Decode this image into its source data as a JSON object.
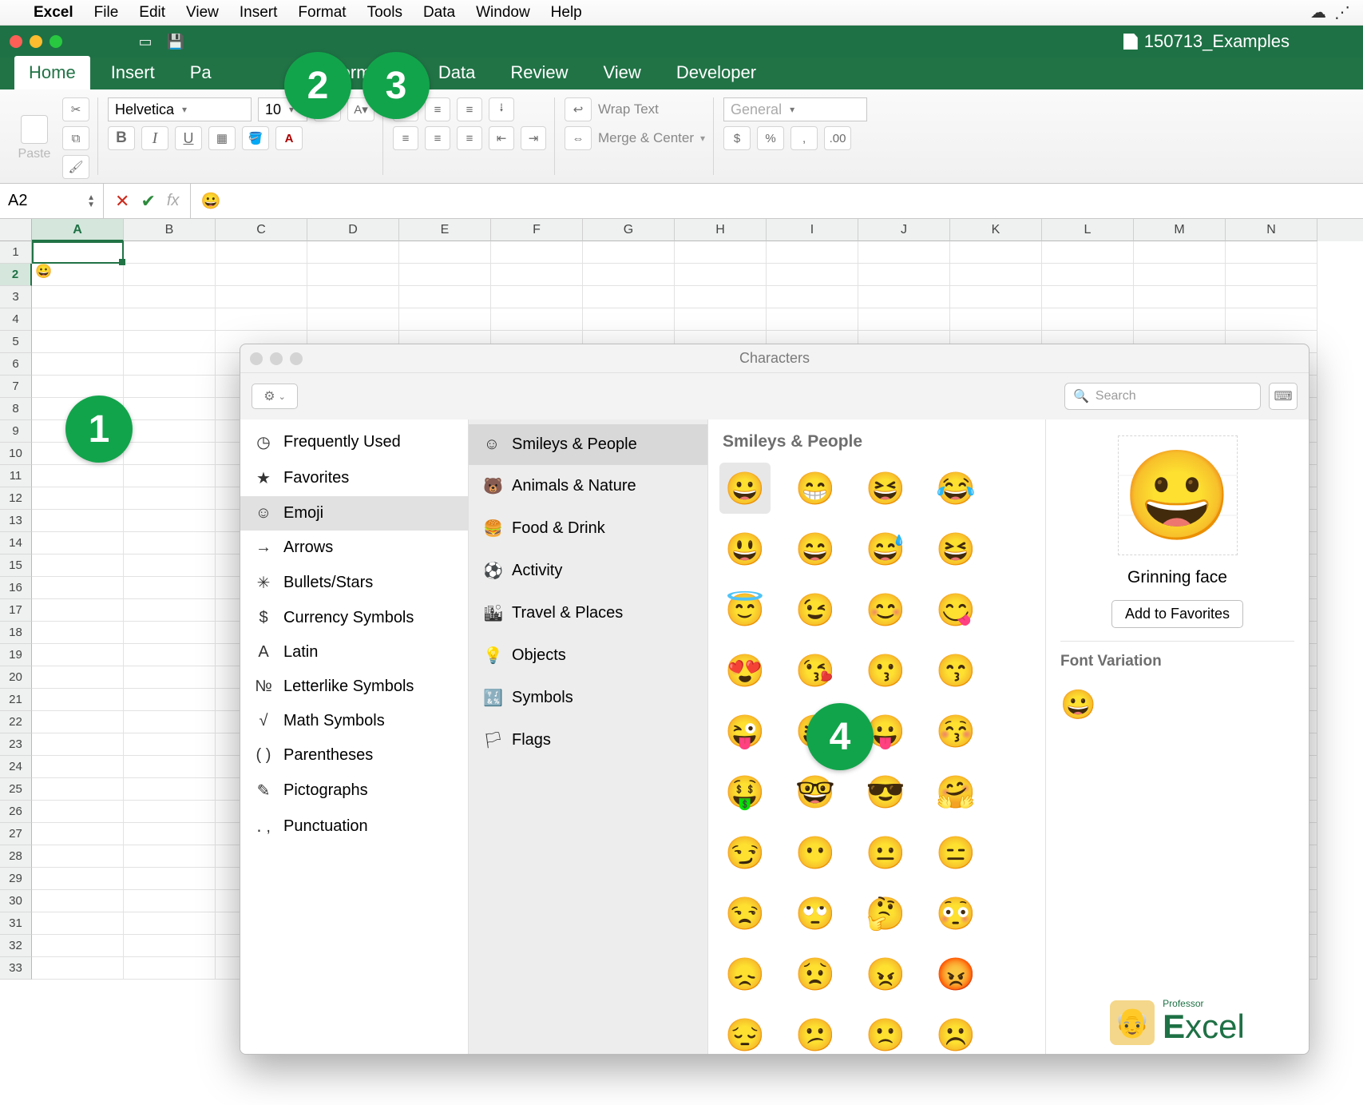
{
  "mac_menu": {
    "app": "Excel",
    "items": [
      "File",
      "Edit",
      "View",
      "Insert",
      "Format",
      "Tools",
      "Data",
      "Window",
      "Help"
    ]
  },
  "doc_title": "150713_Examples",
  "ribbon_tabs": [
    "Home",
    "Insert",
    "Pa",
    "ormulas",
    "Data",
    "Review",
    "View",
    "Developer"
  ],
  "ribbon_active": "Home",
  "paste_label": "Paste",
  "font": {
    "name": "Helvetica",
    "size": "10"
  },
  "wrap_label": "Wrap Text",
  "merge_label": "Merge & Center",
  "num_format": "General",
  "namebox": "A2",
  "formula_value": "😀",
  "columns": [
    "A",
    "B",
    "C",
    "D",
    "E",
    "F",
    "G",
    "H",
    "I",
    "J",
    "K",
    "L",
    "M",
    "N"
  ],
  "active_col": "A",
  "active_row": 2,
  "row_count": 33,
  "cell_A2": "😀",
  "badges": {
    "b1": "1",
    "b2": "2",
    "b3": "3",
    "b4": "4"
  },
  "char_window": {
    "title": "Characters",
    "search_placeholder": "Search",
    "cat1": [
      {
        "icon": "◷",
        "label": "Frequently Used"
      },
      {
        "icon": "★",
        "label": "Favorites"
      },
      {
        "icon": "☺",
        "label": "Emoji",
        "selected": true
      },
      {
        "icon": "→",
        "label": "Arrows"
      },
      {
        "icon": "✳",
        "label": "Bullets/Stars"
      },
      {
        "icon": "$",
        "label": "Currency Symbols"
      },
      {
        "icon": "A",
        "label": "Latin"
      },
      {
        "icon": "№",
        "label": "Letterlike Symbols"
      },
      {
        "icon": "√",
        "label": "Math Symbols"
      },
      {
        "icon": "( )",
        "label": "Parentheses"
      },
      {
        "icon": "✎",
        "label": "Pictographs"
      },
      {
        "icon": "․ ,",
        "label": "Punctuation"
      }
    ],
    "cat2": [
      {
        "icon": "☺",
        "label": "Smileys & People",
        "selected": true
      },
      {
        "icon": "🐻",
        "label": "Animals & Nature"
      },
      {
        "icon": "🍔",
        "label": "Food & Drink"
      },
      {
        "icon": "⚽",
        "label": "Activity"
      },
      {
        "icon": "🏙",
        "label": "Travel & Places"
      },
      {
        "icon": "💡",
        "label": "Objects"
      },
      {
        "icon": "🔣",
        "label": "Symbols"
      },
      {
        "icon": "🏳",
        "label": "Flags"
      }
    ],
    "grid_heading": "Smileys & People",
    "emojis": [
      "😀",
      "😁",
      "😆",
      "😂",
      "😃",
      "😄",
      "😅",
      "😆",
      "😇",
      "😉",
      "😊",
      "😋",
      "😍",
      "😘",
      "😗",
      "😙",
      "😜",
      "😝",
      "😛",
      "😚",
      "🤑",
      "🤓",
      "😎",
      "🤗",
      "😏",
      "😶",
      "😐",
      "😑",
      "😒",
      "🙄",
      "🤔",
      "😳",
      "😞",
      "😟",
      "😠",
      "😡",
      "😔",
      "😕",
      "🙁",
      "☹️"
    ],
    "selected_emoji_index": 0,
    "preview": {
      "glyph": "😀",
      "name": "Grinning face",
      "fav_label": "Add to Favorites",
      "font_variation_label": "Font Variation",
      "variation_glyph": "😀"
    },
    "logo_text_prefix": "E",
    "logo_text_rest": "xcel",
    "logo_sup": "Professor"
  }
}
